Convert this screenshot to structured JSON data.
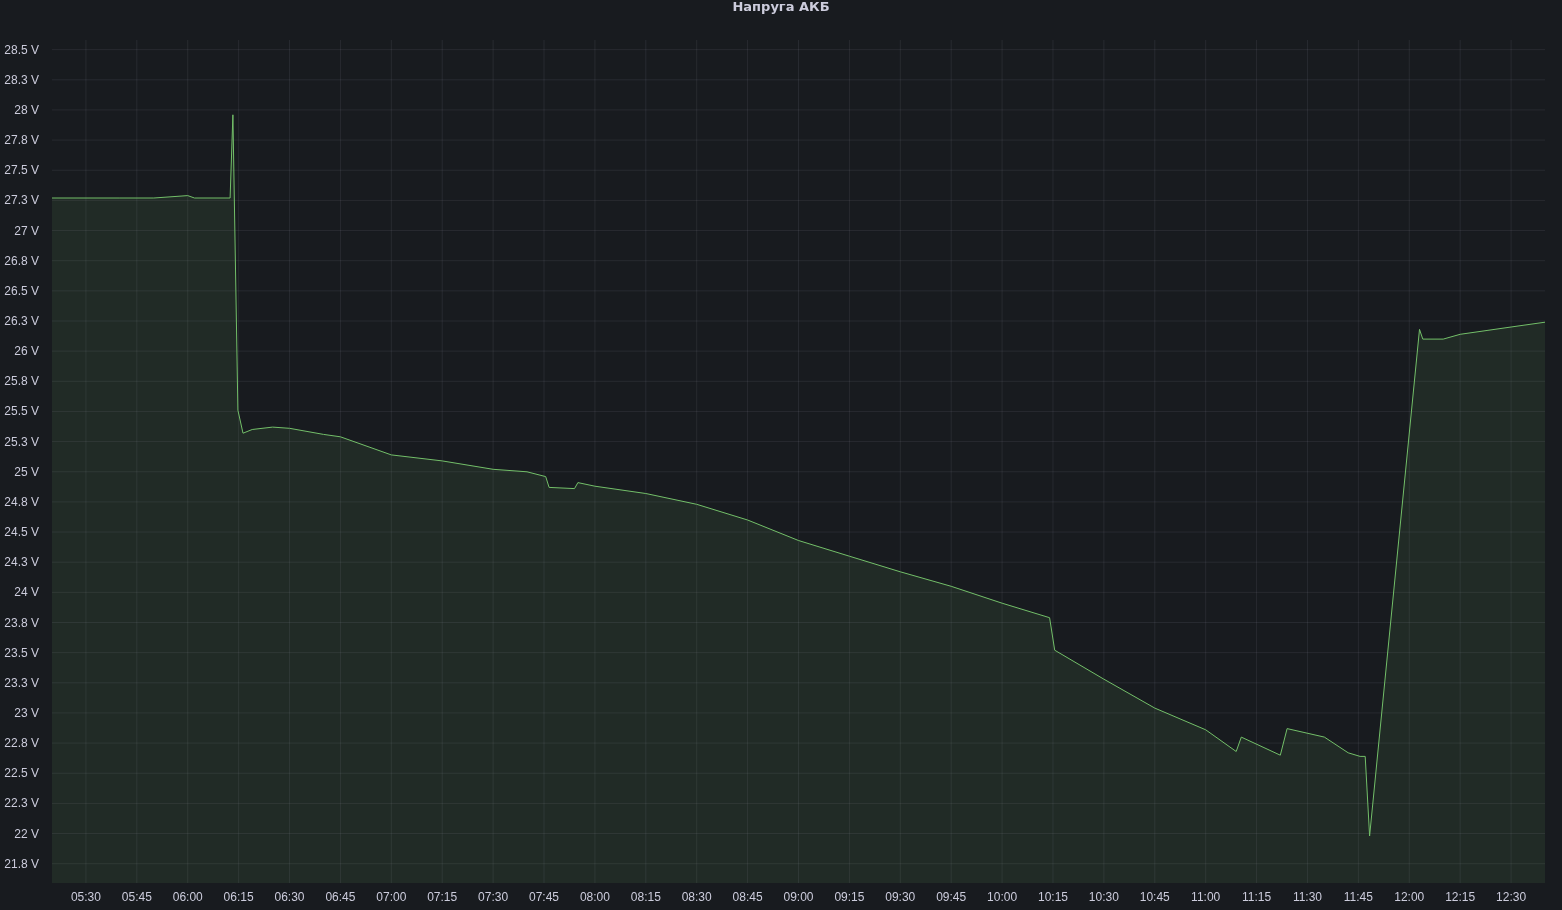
{
  "panel": {
    "chart_data": {
      "type": "area",
      "title": "Напруга АКБ",
      "grid": true,
      "x": [
        320,
        340,
        350,
        360,
        362,
        372.5,
        373.3,
        374.8,
        376.3,
        379,
        385,
        390,
        400,
        405,
        420,
        435,
        450,
        460,
        465.5,
        466.5,
        474,
        475,
        480,
        495,
        510,
        525,
        540,
        555,
        570,
        585,
        600,
        614,
        615.5,
        630,
        645,
        660,
        669,
        670.5,
        682,
        684,
        695,
        702,
        705.5,
        707,
        708.3,
        723,
        724,
        730,
        735,
        750,
        760
      ],
      "series": [
        {
          "color": "#73bf69",
          "values": [
            27.27,
            27.27,
            27.27,
            27.29,
            27.27,
            27.27,
            27.96,
            25.51,
            25.32,
            25.35,
            25.37,
            25.36,
            25.31,
            25.29,
            25.14,
            25.09,
            25.02,
            25.0,
            24.96,
            24.87,
            24.86,
            24.91,
            24.88,
            24.82,
            24.73,
            24.6,
            24.43,
            24.3,
            24.17,
            24.05,
            23.91,
            23.79,
            23.52,
            23.28,
            23.04,
            22.86,
            22.68,
            22.8,
            22.65,
            22.87,
            22.8,
            22.67,
            22.64,
            22.64,
            21.98,
            26.18,
            26.1,
            26.1,
            26.14,
            26.2,
            26.24
          ]
        }
      ],
      "xlim": [
        320,
        760
      ],
      "ylim": [
        21.59,
        28.58
      ],
      "xticks": [
        {
          "value": 330,
          "label": "05:30"
        },
        {
          "value": 345,
          "label": "05:45"
        },
        {
          "value": 360,
          "label": "06:00"
        },
        {
          "value": 375,
          "label": "06:15"
        },
        {
          "value": 390,
          "label": "06:30"
        },
        {
          "value": 405,
          "label": "06:45"
        },
        {
          "value": 420,
          "label": "07:00"
        },
        {
          "value": 435,
          "label": "07:15"
        },
        {
          "value": 450,
          "label": "07:30"
        },
        {
          "value": 465,
          "label": "07:45"
        },
        {
          "value": 480,
          "label": "08:00"
        },
        {
          "value": 495,
          "label": "08:15"
        },
        {
          "value": 510,
          "label": "08:30"
        },
        {
          "value": 525,
          "label": "08:45"
        },
        {
          "value": 540,
          "label": "09:00"
        },
        {
          "value": 555,
          "label": "09:15"
        },
        {
          "value": 570,
          "label": "09:30"
        },
        {
          "value": 585,
          "label": "09:45"
        },
        {
          "value": 600,
          "label": "10:00"
        },
        {
          "value": 615,
          "label": "10:15"
        },
        {
          "value": 630,
          "label": "10:30"
        },
        {
          "value": 645,
          "label": "10:45"
        },
        {
          "value": 660,
          "label": "11:00"
        },
        {
          "value": 675,
          "label": "11:15"
        },
        {
          "value": 690,
          "label": "11:30"
        },
        {
          "value": 705,
          "label": "11:45"
        },
        {
          "value": 720,
          "label": "12:00"
        },
        {
          "value": 735,
          "label": "12:15"
        },
        {
          "value": 750,
          "label": "12:30"
        }
      ],
      "yticks": [
        {
          "value": 21.75,
          "label": "21.8 V"
        },
        {
          "value": 22,
          "label": "22 V"
        },
        {
          "value": 22.25,
          "label": "22.3 V"
        },
        {
          "value": 22.5,
          "label": "22.5 V"
        },
        {
          "value": 22.75,
          "label": "22.8 V"
        },
        {
          "value": 23,
          "label": "23 V"
        },
        {
          "value": 23.25,
          "label": "23.3 V"
        },
        {
          "value": 23.5,
          "label": "23.5 V"
        },
        {
          "value": 23.75,
          "label": "23.8 V"
        },
        {
          "value": 24,
          "label": "24 V"
        },
        {
          "value": 24.25,
          "label": "24.3 V"
        },
        {
          "value": 24.5,
          "label": "24.5 V"
        },
        {
          "value": 24.75,
          "label": "24.8 V"
        },
        {
          "value": 25,
          "label": "25 V"
        },
        {
          "value": 25.25,
          "label": "25.3 V"
        },
        {
          "value": 25.5,
          "label": "25.5 V"
        },
        {
          "value": 25.75,
          "label": "25.8 V"
        },
        {
          "value": 26,
          "label": "26 V"
        },
        {
          "value": 26.25,
          "label": "26.3 V"
        },
        {
          "value": 26.5,
          "label": "26.5 V"
        },
        {
          "value": 26.75,
          "label": "26.8 V"
        },
        {
          "value": 27,
          "label": "27 V"
        },
        {
          "value": 27.25,
          "label": "27.3 V"
        },
        {
          "value": 27.5,
          "label": "27.5 V"
        },
        {
          "value": 27.75,
          "label": "27.8 V"
        },
        {
          "value": 28,
          "label": "28 V"
        },
        {
          "value": 28.25,
          "label": "28.3 V"
        },
        {
          "value": 28.5,
          "label": "28.5 V"
        }
      ]
    }
  }
}
